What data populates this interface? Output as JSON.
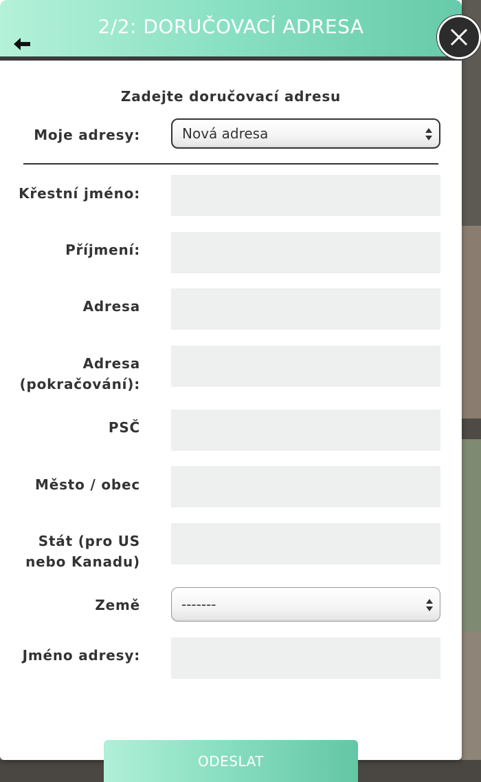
{
  "header": {
    "title": "2/2: DORUČOVACÍ ADRESA",
    "back_icon": "arrow-left-icon",
    "close_icon": "close-icon"
  },
  "form": {
    "heading": "Zadejte doručovací adresu",
    "my_addresses": {
      "label": "Moje adresy:",
      "selected": "Nová adresa"
    },
    "first_name_label": "Křestní jméno:",
    "last_name_label": "Příjmení:",
    "address_label": "Adresa",
    "address2_label_line1": "Adresa",
    "address2_label_line2": "(pokračování):",
    "zip_label": "PSČ",
    "city_label": "Město / obec",
    "state_label_line1": "Stát (pro US",
    "state_label_line2": "nebo Kanadu)",
    "country": {
      "label": "Země",
      "selected": "-------"
    },
    "address_name_label": "Jméno adresy:",
    "submit_label": "ODESLAT"
  }
}
